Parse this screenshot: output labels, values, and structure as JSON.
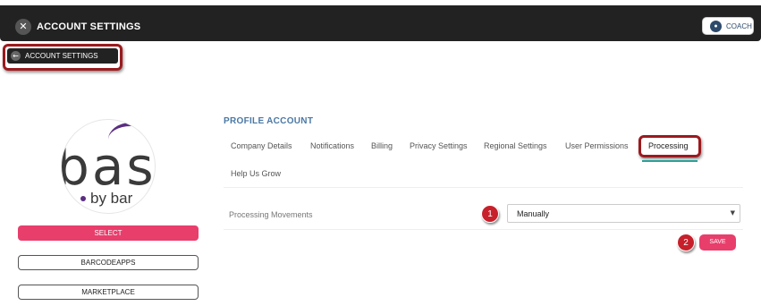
{
  "header": {
    "title": "ACCOUNT SETTINGS",
    "icon": "tools-icon",
    "coach_label": "COACH",
    "coach_icon": "coach-icon"
  },
  "breadcrumb": {
    "label": "ACCOUNT SETTINGS",
    "icon": "back-arrow-icon"
  },
  "sidebar": {
    "logo_text": "bas",
    "logo_sub": "by bar",
    "select_label": "SELECT",
    "buttons": [
      "BARCODEAPPS",
      "MARKETPLACE"
    ]
  },
  "profile": {
    "title": "PROFILE ACCOUNT",
    "tabs": [
      "Company Details",
      "Notifications",
      "Billing",
      "Privacy Settings",
      "Regional Settings",
      "User Permissions",
      "Processing",
      "Help Us Grow"
    ],
    "active_tab": "Processing"
  },
  "form": {
    "field_label": "Processing Movements",
    "select_value": "Manually",
    "save_label": "SAVE"
  },
  "annotations": {
    "step1": "1",
    "step2": "2"
  },
  "colors": {
    "header_bg": "#222222",
    "accent_pink": "#e83e6c",
    "highlight_red": "#9b1a1e",
    "title_blue": "#4a78a5",
    "tab_underline": "#2aa198"
  }
}
